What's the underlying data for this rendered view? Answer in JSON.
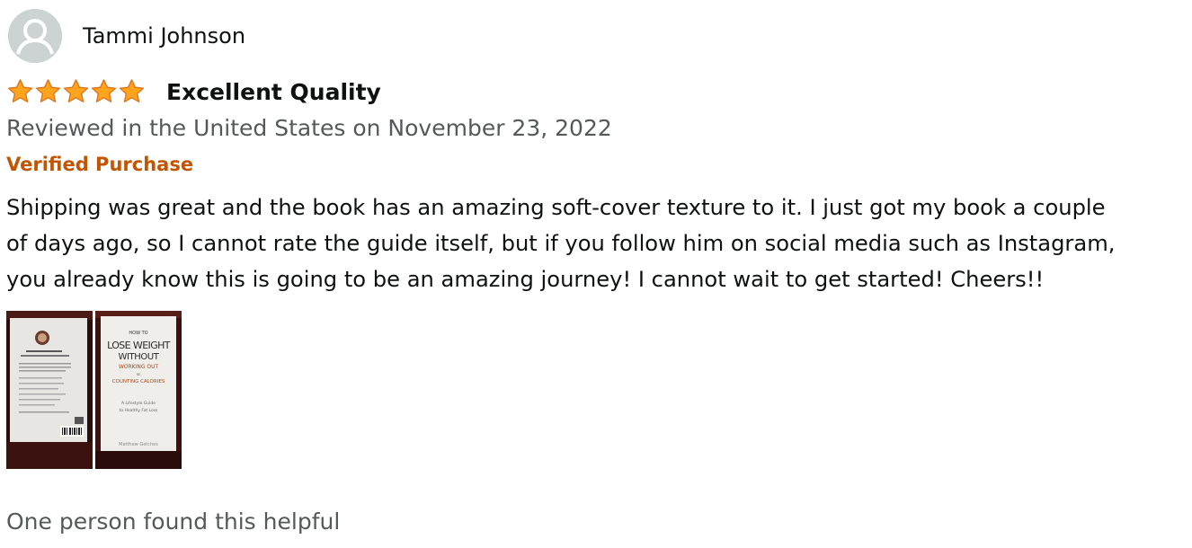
{
  "reviewer": {
    "name": "Tammi Johnson",
    "avatar_icon": "default-user-avatar-icon"
  },
  "review": {
    "rating": 5,
    "rating_max": 5,
    "star_color": "#ffa41c",
    "title": "Excellent Quality",
    "date_line": "Reviewed in the United States on November 23, 2022",
    "verified_label": "Verified Purchase",
    "verified_color": "#c45500",
    "body_lines": [
      "Shipping was great and the book has an amazing soft-cover texture to it. I just got my book a couple",
      "of days ago, so I cannot rate the guide itself, but if you follow him on social media such as Instagram,",
      "you already know this is going to be an amazing journey! I cannot wait to get started! Cheers!!"
    ],
    "helpful_text": "One person found this helpful"
  },
  "images": {
    "back_cover": {
      "description_icon": "book-back-cover-photo"
    },
    "front_cover": {
      "title_line1": "HOW TO",
      "title_line2": "LOSE WEIGHT",
      "title_line3": "WITHOUT",
      "title_line4": "WORKING OUT",
      "title_line5": "or",
      "title_line6": "COUNTING CALORIES",
      "subtitle_line1": "A Lifestyle Guide",
      "subtitle_line2": "to Healthy Fat Loss",
      "author": "Matthew Getches"
    }
  }
}
